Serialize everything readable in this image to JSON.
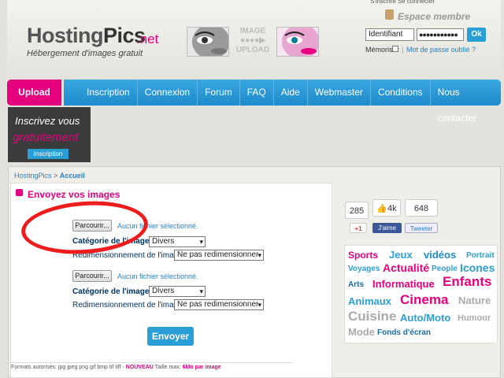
{
  "header": {
    "topstrip": "S'inscrire  Se connecter",
    "logo_hosting": "Hosting",
    "logo_pics": "Pics",
    "logo_net": ".net",
    "tagline": "Hébergement d'images gratuit",
    "upload_word_1": "IMAGE",
    "upload_arrow": "●●●●▶",
    "upload_word_2": "UPLOAD"
  },
  "login": {
    "title": "Espace membre",
    "username_value": "Identifiant",
    "password_value": "●●●●●●●●●●●",
    "ok_label": "Ok",
    "remember_label": "Mémoriser",
    "forgot_label": "Mot de passe oublié ?",
    "separator": "|"
  },
  "nav": {
    "upload_label": "Upload",
    "items": [
      "Inscription",
      "Connexion",
      "Forum",
      "FAQ",
      "Aide",
      "Webmaster",
      "Conditions",
      "Nous contacter"
    ]
  },
  "promo": {
    "line1": "Inscrivez vous",
    "line2": "gratuitement",
    "button": "Inscription"
  },
  "breadcrumb": {
    "root": "HostingPics",
    "separator": " > ",
    "current": "Accueil"
  },
  "upload_panel": {
    "title": "Envoyez vos images",
    "rows": [
      {
        "browse_label": "Parcourir...",
        "no_file": "Aucun fichier sélectionné.",
        "category_label": "Catégorie de l'image :",
        "category_value": "Divers",
        "resize_label": "Redimensionnement de l'image",
        "resize_value": "Ne pas redimensionner"
      },
      {
        "browse_label": "Parcourir...",
        "no_file": "Aucun fichier sélectionné.",
        "category_label": "Catégorie de l'image :",
        "category_value": "Divers",
        "resize_label": "Redimensionnement de l'image",
        "resize_value": "Ne pas redimensionner"
      }
    ],
    "submit_label": "Envoyer",
    "formats_prefix": "Formats autorisés: jpg jpeg png gif bmp tif tiff - ",
    "formats_new": "NOUVEAU",
    "formats_size": " Taille max: ",
    "formats_max": "6Mo par image"
  },
  "social": {
    "count_1": "285",
    "count_2": "4k",
    "count_3": "648",
    "gplus_label": "+1",
    "fb_label": "J'aime",
    "tw_label": "Tweeter"
  },
  "tag_cloud": [
    {
      "label": "Sports",
      "color": "#e4007f"
    },
    {
      "label": "Jeux",
      "color": "#2a9fd6"
    },
    {
      "label": "vidéos",
      "color": "#1e8bcb"
    },
    {
      "label": "Portrait",
      "color": "#2a9fd6"
    },
    {
      "label": "Voyages",
      "color": "#2a9fd6"
    },
    {
      "label": "Actualité",
      "color": "#e4007f"
    },
    {
      "label": "People",
      "color": "#2a9fd6"
    },
    {
      "label": "Icones",
      "color": "#2a9fd6"
    },
    {
      "label": "Arts",
      "color": "#1e6aa0"
    },
    {
      "label": "Informatique",
      "color": "#e4007f"
    },
    {
      "label": "Enfants",
      "color": "#e4007f"
    },
    {
      "label": "Animaux",
      "color": "#2a9fd6"
    },
    {
      "label": "Cinema",
      "color": "#e4007f"
    },
    {
      "label": "Nature",
      "color": "#aaaaaa"
    },
    {
      "label": "Cuisine",
      "color": "#aaaaaa"
    },
    {
      "label": "Auto/Moto",
      "color": "#2a9fd6"
    },
    {
      "label": "Humour",
      "color": "#aaaaaa"
    },
    {
      "label": "Mode",
      "color": "#aaaaaa"
    },
    {
      "label": "Fonds d'écran",
      "color": "#1e6aa0"
    }
  ]
}
